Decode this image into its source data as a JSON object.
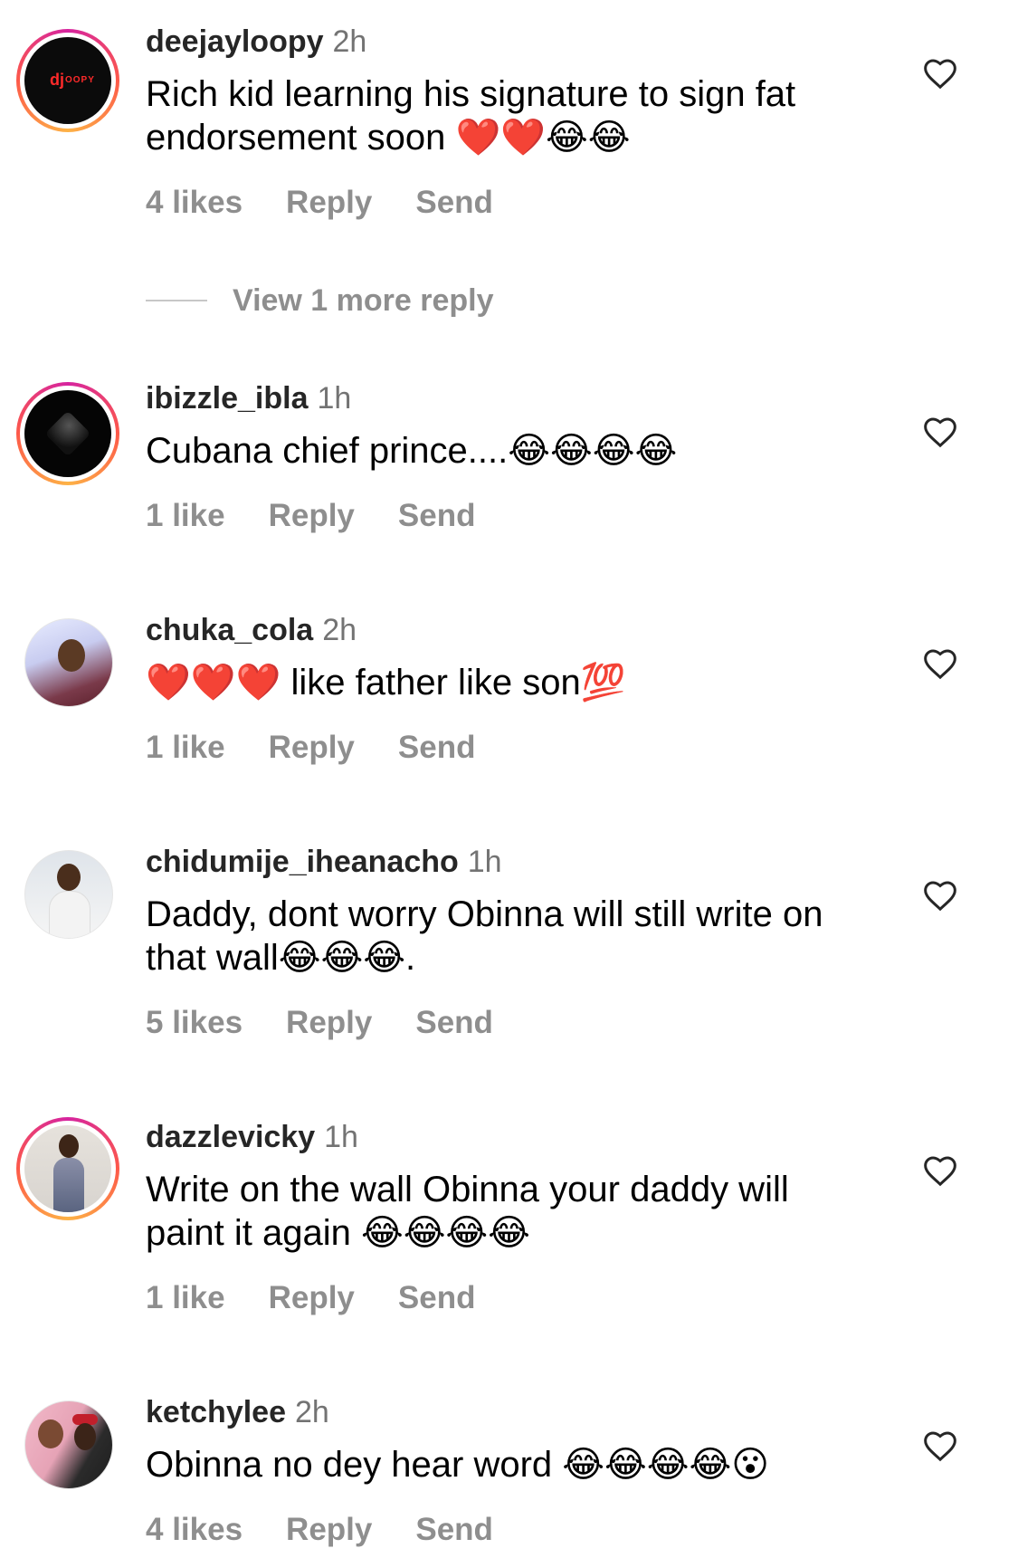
{
  "comments": [
    {
      "username": "deejayloopy",
      "time": "2h",
      "text": "Rich kid learning his signature to sign fat endorsement soon ❤️❤️😂😂",
      "likes": "4 likes",
      "reply": "Reply",
      "send": "Send",
      "avatar_logo": "djoopy"
    },
    {
      "username": "ibizzle_ibla",
      "time": "1h",
      "text": "Cubana chief prince....😂😂😂😂",
      "likes": "1 like",
      "reply": "Reply",
      "send": "Send"
    },
    {
      "username": "chuka_cola",
      "time": "2h",
      "text": "❤️❤️❤️ like father like son💯",
      "likes": "1 like",
      "reply": "Reply",
      "send": "Send"
    },
    {
      "username": "chidumije_iheanacho",
      "time": "1h",
      "text": "Daddy, dont worry Obinna will still write on that wall😂😂😂.",
      "likes": "5 likes",
      "reply": "Reply",
      "send": "Send"
    },
    {
      "username": "dazzlevicky",
      "time": "1h",
      "text": "Write on the wall Obinna your daddy will paint it again 😂😂😂😂",
      "likes": "1 like",
      "reply": "Reply",
      "send": "Send"
    },
    {
      "username": "ketchylee",
      "time": "2h",
      "text": "Obinna no dey hear word 😂😂😂😂😮",
      "likes": "4 likes",
      "reply": "Reply",
      "send": "Send"
    }
  ],
  "view_more_replies": "View 1 more reply",
  "icons": {
    "like": "heart-outline-icon"
  }
}
